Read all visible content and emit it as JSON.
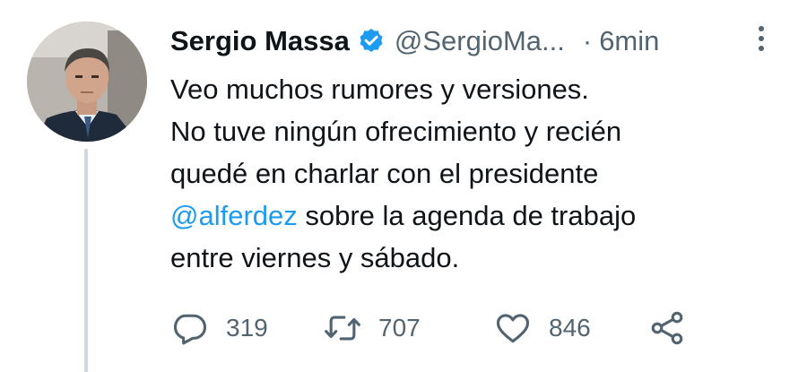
{
  "tweet": {
    "display_name": "Sergio Massa",
    "handle": "@SergioMa...",
    "separator": "·",
    "time": "6min",
    "body": {
      "line1": "Veo muchos rumores y versiones.",
      "line2": "No tuve ningún ofrecimiento y recién",
      "line3": "quedé en charlar con el presidente",
      "line4_mention": "@alferdez",
      "line4_rest": " sobre la agenda de trabajo",
      "line5": "entre viernes y sábado."
    },
    "counts": {
      "replies": "319",
      "retweets": "707",
      "likes": "846"
    }
  },
  "icons": {
    "verified": "verified-badge-icon",
    "more": "more-vertical-icon",
    "reply": "reply-icon",
    "retweet": "retweet-icon",
    "like": "heart-icon",
    "share": "share-icon"
  },
  "colors": {
    "text": "#0f1419",
    "secondary": "#536471",
    "accent": "#1d9bf0",
    "thread_line": "#cfd9de"
  }
}
